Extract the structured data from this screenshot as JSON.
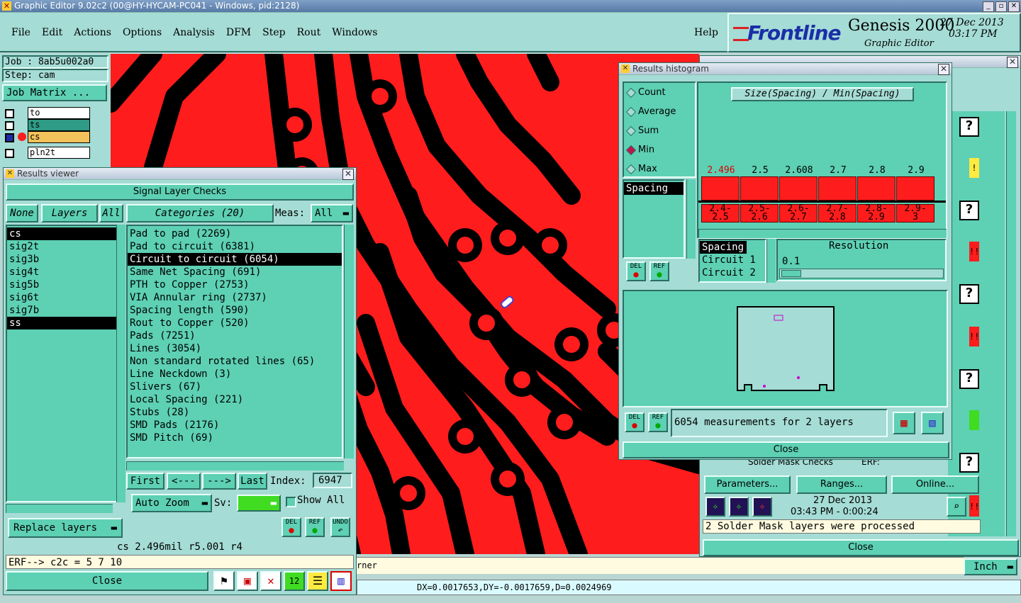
{
  "window_title": "Graphic Editor 9.02c2 (00@HY-HYCAM-PC041 - Windows, pid:2128)",
  "menu": [
    "File",
    "Edit",
    "Actions",
    "Options",
    "Analysis",
    "DFM",
    "Step",
    "Rout",
    "Windows"
  ],
  "help": "Help",
  "brand": {
    "logo": "Frontline",
    "product": "Genesis 2000",
    "subtitle": "Graphic Editor",
    "date": "27 Dec 2013",
    "time": "03:17 PM"
  },
  "job": {
    "job": "Job : 8ab5u002a0",
    "step": "Step: cam",
    "matrix_button": "Job Matrix ..."
  },
  "layer_strip": [
    {
      "name": "to",
      "bg": "#ffffff"
    },
    {
      "name": "ts",
      "bg": "#2e9c86"
    },
    {
      "name": "cs",
      "bg": "#f4c25a"
    },
    {
      "name": "pln2t",
      "bg": "#ffffff"
    }
  ],
  "results_viewer": {
    "title": "Results viewer",
    "header": "Signal Layer Checks",
    "none_btn": "None",
    "layers_btn": "Layers",
    "all_btn": "All",
    "layers": [
      "cs",
      "sig2t",
      "sig3b",
      "sig4t",
      "sig5b",
      "sig6t",
      "sig7b",
      "ss"
    ],
    "categories_btn": "Categories (20)",
    "meas_label": "Meas:",
    "meas_value": "All",
    "categories": [
      "Pad to pad (2269)",
      "Pad to circuit (6381)",
      "Circuit to circuit (6054)",
      "Same Net Spacing (691)",
      "PTH to Copper (2753)",
      "VIA Annular ring (2737)",
      "Spacing length (590)",
      "Rout to Copper (520)",
      "Pads (7251)",
      "Lines (3054)",
      "Non standard rotated lines (65)",
      "Line Neckdown (3)",
      "Slivers (67)",
      "Local Spacing (221)",
      "Stubs (28)",
      "SMD Pads (2176)",
      "SMD Pitch (69)"
    ],
    "first": "First",
    "prev": "<---",
    "next": "--->",
    "last": "Last",
    "index_label": "Index:",
    "index_value": "6947",
    "auto_zoom": "Auto Zoom",
    "sv_label": "Sv:",
    "show_all": "Show All",
    "replace_layers": "Replace layers",
    "status": "cs 2.496mil  r5.001  r4",
    "erf": "ERF--> c2c = 5 7 10",
    "close": "Close",
    "del": "DEL",
    "ref": "REF",
    "undo": "UNDO"
  },
  "histogram": {
    "title": "Results histogram",
    "options": [
      "Count",
      "Average",
      "Sum",
      "Min",
      "Max"
    ],
    "selected_option": "Min",
    "chart_title": "Size(Spacing) / Min(Spacing)",
    "bar_values": [
      "2.496",
      "2.5",
      "2.608",
      "2.7",
      "2.8",
      "2.9"
    ],
    "ranges": [
      [
        "2.4-",
        "2.5"
      ],
      [
        "2.5-",
        "2.6"
      ],
      [
        "2.6-",
        "2.7"
      ],
      [
        "2.7-",
        "2.8"
      ],
      [
        "2.8-",
        "2.9"
      ],
      [
        "2.9-",
        "3"
      ]
    ],
    "measure_list": [
      "Spacing"
    ],
    "measures": [
      "Spacing",
      "Circuit 1",
      "Circuit 2"
    ],
    "resolution_label": "Resolution",
    "resolution_value": "0.1",
    "summary": "6054 measurements for 2 layers",
    "close": "Close",
    "del": "DEL",
    "ref": "REF"
  },
  "checklist": {
    "solder_mask_row": "Solder Mask Checks",
    "erf": "ERF:",
    "parameters": "Parameters...",
    "ranges": "Ranges...",
    "online": "Online...",
    "date": "27 Dec 2013",
    "time": "03:43 PM - 0:00:24",
    "processed": "2 Solder Mask layers were processed",
    "close": "Close"
  },
  "bottom": {
    "hint": "rner",
    "units": "Inch",
    "coords": "DX=0.0017653,DY=-0.0017659,D=0.0024969"
  }
}
